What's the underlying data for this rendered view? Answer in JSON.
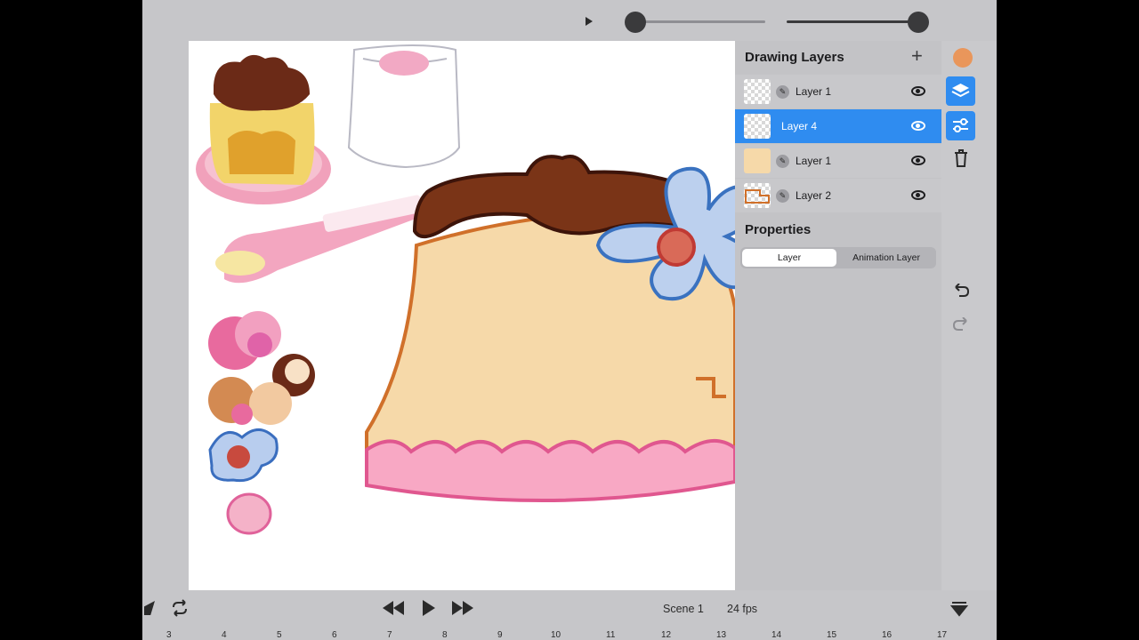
{
  "top_bar": {
    "play_icon": "play-small-icon",
    "scrubber_value": 0,
    "brush_size_value": 1
  },
  "layers_panel": {
    "title": "Drawing Layers",
    "add_icon": "plus-icon",
    "layers": [
      {
        "label": "Layer 1",
        "selected": false
      },
      {
        "label": "Layer 4",
        "selected": true
      },
      {
        "label": "Layer 1",
        "selected": false
      },
      {
        "label": "Layer 2",
        "selected": false
      }
    ]
  },
  "properties": {
    "title": "Properties",
    "tabs": [
      {
        "label": "Layer",
        "active": true
      },
      {
        "label": "Animation Layer",
        "active": false
      }
    ]
  },
  "right_rail": {
    "color": "#e9965b",
    "icons": [
      "color-swatch",
      "layers-icon",
      "sliders-icon",
      "trash-icon",
      "undo-icon",
      "redo-icon"
    ]
  },
  "bottom_bar": {
    "scene": "Scene 1",
    "fps": "24 fps",
    "ruler": [
      "3",
      "4",
      "5",
      "6",
      "7",
      "8",
      "9",
      "10",
      "11",
      "12",
      "13",
      "14",
      "15",
      "16",
      "17"
    ]
  },
  "colors": {
    "accent": "#2f8cf0",
    "canvas": "#ffffff"
  }
}
